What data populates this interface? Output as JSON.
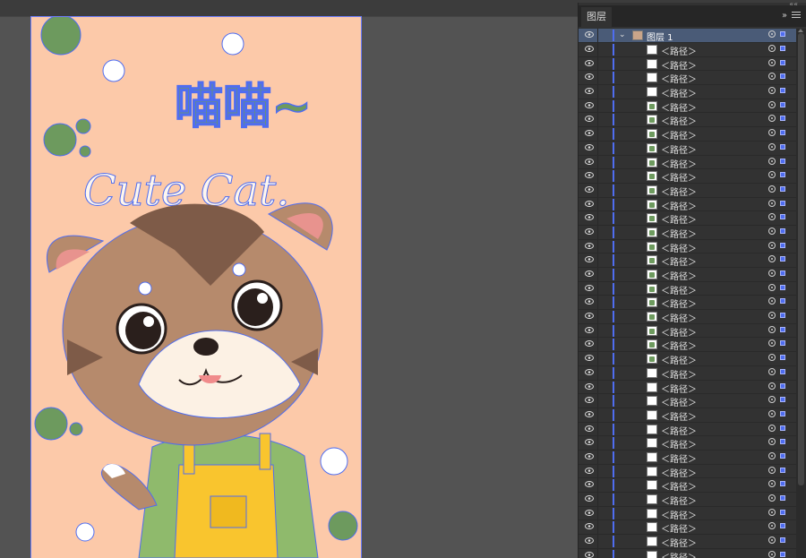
{
  "panel": {
    "tab_label": "图层",
    "collapse_glyph": "››",
    "top_glyph": "««",
    "layer_header": {
      "label": "图层 1",
      "chevron": "⌄"
    }
  },
  "layers": [
    {
      "label": "＜路径＞",
      "thumb": "blank"
    },
    {
      "label": "＜路径＞",
      "thumb": "blank"
    },
    {
      "label": "＜路径＞",
      "thumb": "blank"
    },
    {
      "label": "＜路径＞",
      "thumb": "blank"
    },
    {
      "label": "＜路径＞",
      "thumb": "green"
    },
    {
      "label": "＜路径＞",
      "thumb": "green"
    },
    {
      "label": "＜路径＞",
      "thumb": "green"
    },
    {
      "label": "＜路径＞",
      "thumb": "green"
    },
    {
      "label": "＜路径＞",
      "thumb": "green"
    },
    {
      "label": "＜路径＞",
      "thumb": "green"
    },
    {
      "label": "＜路径＞",
      "thumb": "green"
    },
    {
      "label": "＜路径＞",
      "thumb": "green"
    },
    {
      "label": "＜路径＞",
      "thumb": "green"
    },
    {
      "label": "＜路径＞",
      "thumb": "green"
    },
    {
      "label": "＜路径＞",
      "thumb": "green"
    },
    {
      "label": "＜路径＞",
      "thumb": "green"
    },
    {
      "label": "＜路径＞",
      "thumb": "green"
    },
    {
      "label": "＜路径＞",
      "thumb": "green"
    },
    {
      "label": "＜路径＞",
      "thumb": "green"
    },
    {
      "label": "＜路径＞",
      "thumb": "green"
    },
    {
      "label": "＜路径＞",
      "thumb": "green"
    },
    {
      "label": "＜路径＞",
      "thumb": "green"
    },
    {
      "label": "＜路径＞",
      "thumb": "green"
    },
    {
      "label": "＜路径＞",
      "thumb": "blank"
    },
    {
      "label": "＜路径＞",
      "thumb": "blank"
    },
    {
      "label": "＜路径＞",
      "thumb": "blank"
    },
    {
      "label": "＜路径＞",
      "thumb": "blank"
    },
    {
      "label": "＜路径＞",
      "thumb": "blank"
    },
    {
      "label": "＜路径＞",
      "thumb": "blank"
    },
    {
      "label": "＜路径＞",
      "thumb": "blank"
    },
    {
      "label": "＜路径＞",
      "thumb": "blank"
    },
    {
      "label": "＜路径＞",
      "thumb": "blank"
    },
    {
      "label": "＜路径＞",
      "thumb": "blank"
    },
    {
      "label": "＜路径＞",
      "thumb": "blank"
    },
    {
      "label": "＜路径＞",
      "thumb": "blank"
    },
    {
      "label": "＜路径＞",
      "thumb": "blank"
    },
    {
      "label": "＜路径＞",
      "thumb": "blank"
    }
  ],
  "artwork": {
    "title_cn": "喵喵~",
    "title_en": "Cute Cat."
  },
  "colors": {
    "artboard_bg": "#fcc9a9",
    "selection_blue": "#4f6df0",
    "panel_header": "#4a5b77",
    "green_thumb": "#6d9a5e"
  }
}
